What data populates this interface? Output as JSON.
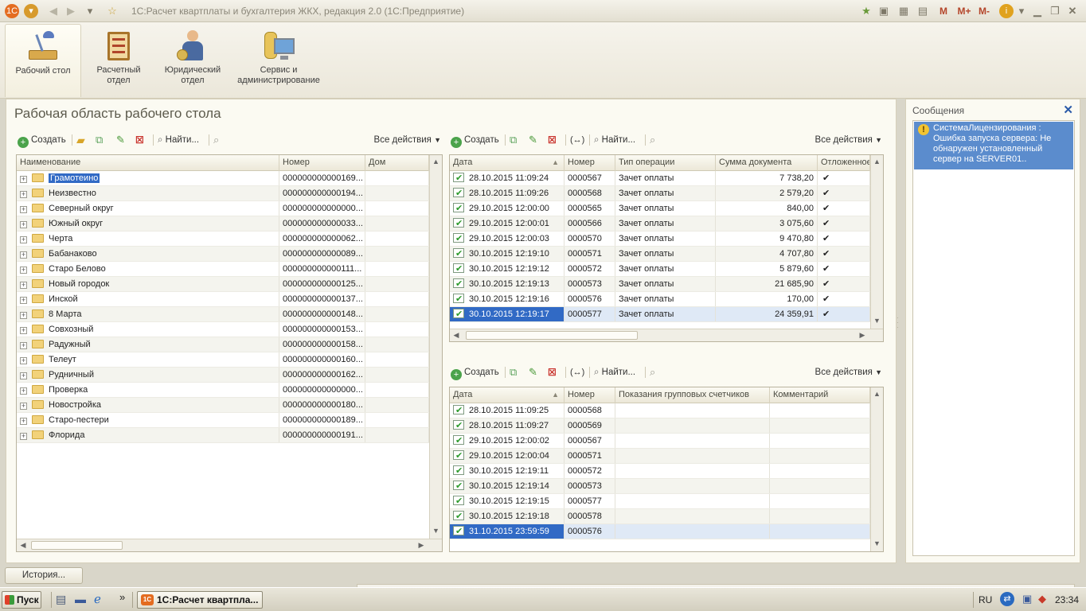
{
  "window": {
    "title": "1С:Расчет квартплаты и бухгалтерия ЖКХ, редакция 2.0  (1С:Предприятие)",
    "memory_buttons": [
      "M",
      "M+",
      "M-"
    ]
  },
  "sections": [
    {
      "label": "Рабочий стол",
      "icon": "desk-lamp-icon",
      "active": true
    },
    {
      "label": "Расчетный отдел",
      "icon": "abacus-icon",
      "active": false
    },
    {
      "label": "Юридический отдел",
      "icon": "lawyer-icon",
      "active": false
    },
    {
      "label": "Сервис и администрирование",
      "icon": "server-monitor-icon",
      "active": false
    }
  ],
  "workarea": {
    "title": "Рабочая область рабочего стола",
    "toolbar": {
      "create": "Создать",
      "find": "Найти...",
      "all_actions": "Все действия"
    }
  },
  "left_grid": {
    "columns": [
      "Наименование",
      "Номер",
      "Дом"
    ],
    "rows": [
      {
        "name": "Грамотеино",
        "number": "000000000000169..."
      },
      {
        "name": "Неизвестно",
        "number": "000000000000194..."
      },
      {
        "name": "Северный округ",
        "number": "000000000000000..."
      },
      {
        "name": "Южный округ",
        "number": "000000000000033..."
      },
      {
        "name": "Черта",
        "number": "000000000000062..."
      },
      {
        "name": "Бабанаково",
        "number": "000000000000089..."
      },
      {
        "name": "Старо Белово",
        "number": "000000000000111..."
      },
      {
        "name": "Новый городок",
        "number": "000000000000125..."
      },
      {
        "name": "Инской",
        "number": "000000000000137..."
      },
      {
        "name": "8  Марта",
        "number": "000000000000148..."
      },
      {
        "name": "Совхозный",
        "number": "000000000000153..."
      },
      {
        "name": "Радужный",
        "number": "000000000000158..."
      },
      {
        "name": "Телеут",
        "number": "000000000000160..."
      },
      {
        "name": "Рудничный",
        "number": "000000000000162..."
      },
      {
        "name": "Проверка",
        "number": "000000000000000..."
      },
      {
        "name": "Новостройка",
        "number": "000000000000180..."
      },
      {
        "name": "Старо-пестери",
        "number": "000000000000189..."
      },
      {
        "name": "Флорида",
        "number": "000000000000191..."
      }
    ]
  },
  "top_right_grid": {
    "columns": [
      "Дата",
      "Номер",
      "Тип операции",
      "Сумма документа",
      "Отложенное"
    ],
    "rows": [
      {
        "date": "28.10.2015 11:09:24",
        "number": "0000567",
        "type": "Зачет оплаты",
        "sum": "7 738,20",
        "deferred": "✔"
      },
      {
        "date": "28.10.2015 11:09:26",
        "number": "0000568",
        "type": "Зачет оплаты",
        "sum": "2 579,20",
        "deferred": "✔"
      },
      {
        "date": "29.10.2015 12:00:00",
        "number": "0000565",
        "type": "Зачет оплаты",
        "sum": "840,00",
        "deferred": "✔"
      },
      {
        "date": "29.10.2015 12:00:01",
        "number": "0000566",
        "type": "Зачет оплаты",
        "sum": "3 075,60",
        "deferred": "✔"
      },
      {
        "date": "29.10.2015 12:00:03",
        "number": "0000570",
        "type": "Зачет оплаты",
        "sum": "9 470,80",
        "deferred": "✔"
      },
      {
        "date": "30.10.2015 12:19:10",
        "number": "0000571",
        "type": "Зачет оплаты",
        "sum": "4 707,80",
        "deferred": "✔"
      },
      {
        "date": "30.10.2015 12:19:12",
        "number": "0000572",
        "type": "Зачет оплаты",
        "sum": "5 879,60",
        "deferred": "✔"
      },
      {
        "date": "30.10.2015 12:19:13",
        "number": "0000573",
        "type": "Зачет оплаты",
        "sum": "21 685,90",
        "deferred": "✔"
      },
      {
        "date": "30.10.2015 12:19:16",
        "number": "0000576",
        "type": "Зачет оплаты",
        "sum": "170,00",
        "deferred": "✔"
      },
      {
        "date": "30.10.2015 12:19:17",
        "number": "0000577",
        "type": "Зачет оплаты",
        "sum": "24 359,91",
        "deferred": "✔"
      }
    ]
  },
  "bottom_right_grid": {
    "columns": [
      "Дата",
      "Номер",
      "Показания групповых счетчиков",
      "Комментарий"
    ],
    "rows": [
      {
        "date": "28.10.2015 11:09:25",
        "number": "0000568"
      },
      {
        "date": "28.10.2015 11:09:27",
        "number": "0000569"
      },
      {
        "date": "29.10.2015 12:00:02",
        "number": "0000567"
      },
      {
        "date": "29.10.2015 12:00:04",
        "number": "0000571"
      },
      {
        "date": "30.10.2015 12:19:11",
        "number": "0000572"
      },
      {
        "date": "30.10.2015 12:19:14",
        "number": "0000573"
      },
      {
        "date": "30.10.2015 12:19:15",
        "number": "0000577"
      },
      {
        "date": "30.10.2015 12:19:18",
        "number": "0000578"
      },
      {
        "date": "31.10.2015 23:59:59",
        "number": "0000576"
      }
    ]
  },
  "messages": {
    "title": "Сообщения",
    "items": [
      "СистемаЛицензирования : Ошибка запуска сервера: Не обнаружен установленный сервер на SERVER01.."
    ]
  },
  "history": {
    "label": "История..."
  },
  "taskbar": {
    "start": "Пуск",
    "app": "1С:Расчет квартпла...",
    "lang": "RU",
    "time": "23:34",
    "more": "»"
  },
  "colors": {
    "selection": "#316ac5",
    "message_bg": "#5b8ccd",
    "accent_green": "#2a9a2a"
  }
}
